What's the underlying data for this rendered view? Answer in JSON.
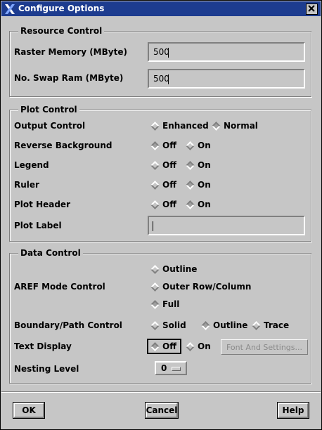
{
  "window": {
    "title": "Configure Options"
  },
  "resource": {
    "legend": "Resource Control",
    "raster_label": "Raster Memory (MByte)",
    "raster_value": "500",
    "swap_label": "No. Swap Ram (MByte)",
    "swap_value": "500"
  },
  "plot": {
    "legend": "Plot Control",
    "output_label": "Output Control",
    "output_opt1": "Enhanced",
    "output_opt2": "Normal",
    "reverse_label": "Reverse Background",
    "legend_label": "Legend",
    "ruler_label": "Ruler",
    "header_label": "Plot Header",
    "plotlabel_label": "Plot Label",
    "plotlabel_value": "",
    "off": "Off",
    "on": "On"
  },
  "data": {
    "legend": "Data Control",
    "aref_label": "AREF Mode Control",
    "aref_opt1": "Outline",
    "aref_opt2": "Outer Row/Column",
    "aref_opt3": "Full",
    "boundary_label": "Boundary/Path Control",
    "boundary_opt1": "Solid",
    "boundary_opt2": "Outline",
    "boundary_opt3": "Trace",
    "text_label": "Text Display",
    "font_button": "Font And Settings...",
    "nesting_label": "Nesting Level",
    "nesting_value": "0"
  },
  "buttons": {
    "ok": "OK",
    "cancel": "Cancel",
    "help": "Help"
  }
}
